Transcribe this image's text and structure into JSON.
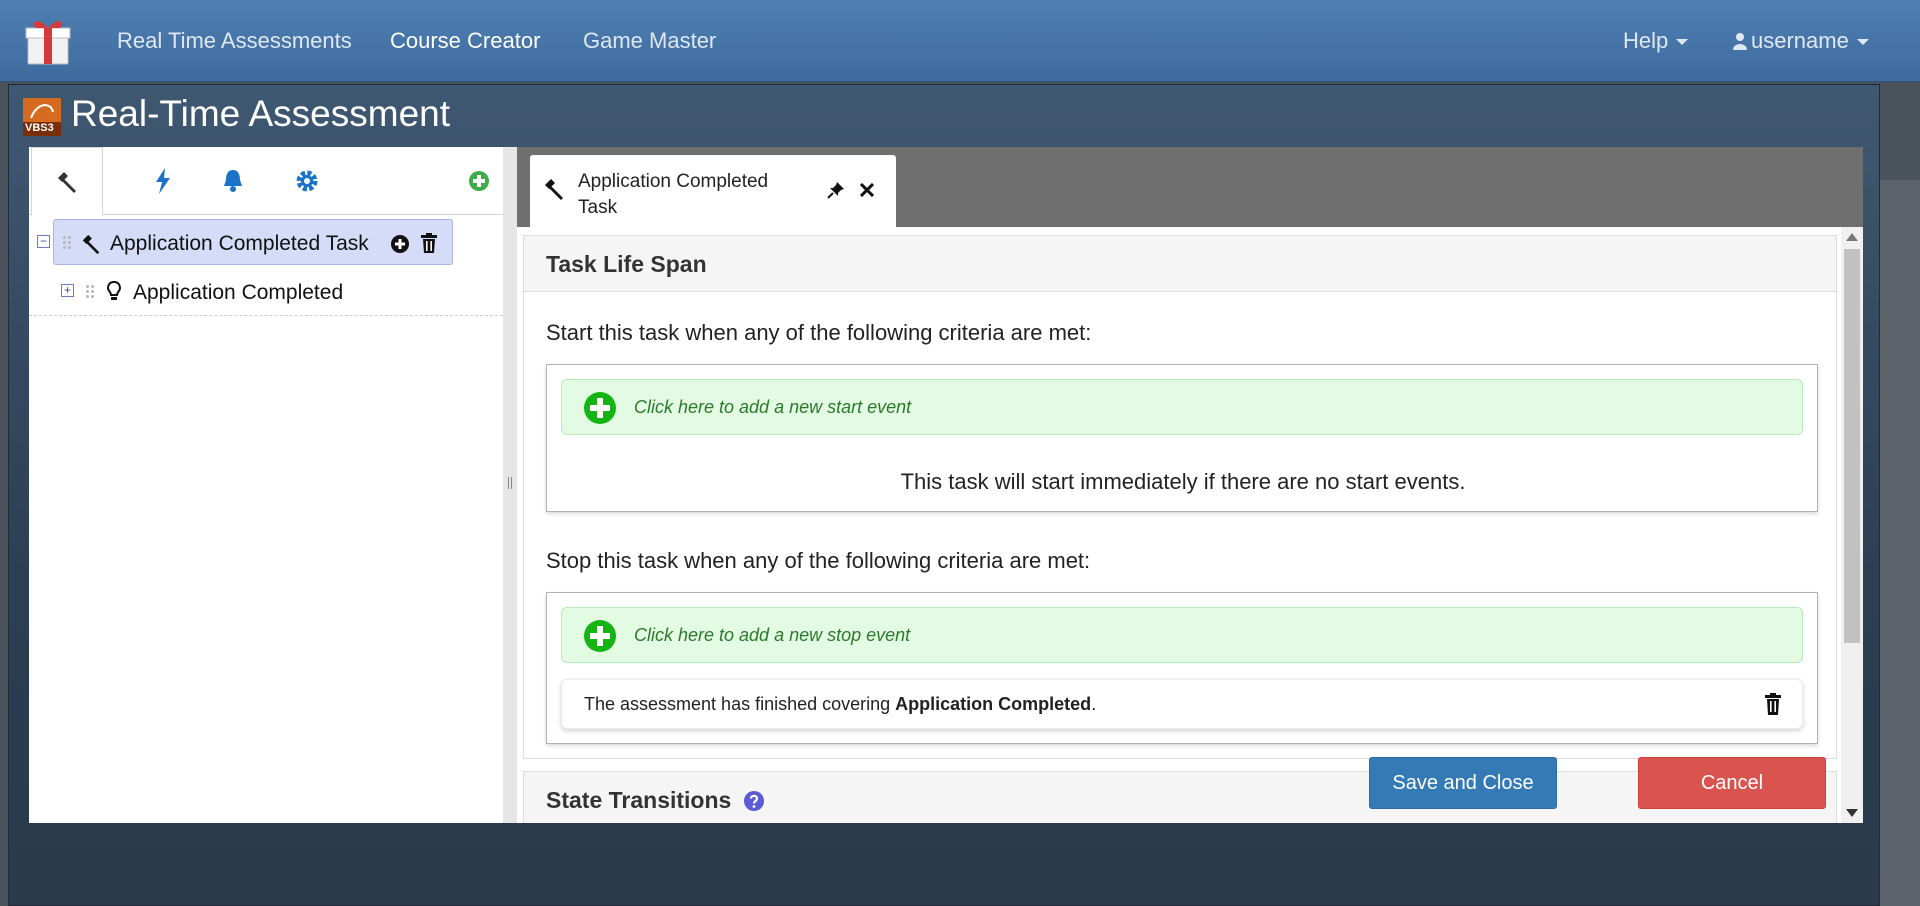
{
  "nav": {
    "logo_icon": "gift-icon",
    "links": [
      "Real Time Assessments",
      "Course Creator",
      "Game Master"
    ],
    "active": "Course Creator",
    "help": "Help",
    "user": "username"
  },
  "modal": {
    "title": "Real-Time Assessment",
    "logo_text": "VBS3"
  },
  "left": {
    "tabs": [
      "hammer-icon",
      "lightning-icon",
      "bell-icon",
      "gear-icon"
    ],
    "tree": [
      {
        "label": "Application Completed Task",
        "icon": "hammer-icon"
      },
      {
        "label": "Application Completed",
        "icon": "lightbulb-icon"
      }
    ]
  },
  "doc_tab": {
    "label": "Application Completed Task"
  },
  "life_span": {
    "heading": "Task Life Span",
    "start_label": "Start this task when any of the following criteria are met:",
    "start_add": "Click here to add a new start event",
    "start_info": "This task will start immediately if there are no start events.",
    "stop_label": "Stop this task when any of the following criteria are met:",
    "stop_add": "Click here to add a new stop event",
    "stop_event_prefix": "The assessment has finished covering ",
    "stop_event_bold": "Application Completed",
    "stop_event_suffix": "."
  },
  "transitions": {
    "heading": "State Transitions"
  },
  "footer": {
    "save": "Save and Close",
    "cancel": "Cancel"
  },
  "colors": {
    "nav": "#4a7aae",
    "primary": "#337ab7",
    "danger": "#d9534f",
    "accent_green": "#15b415",
    "icon_blue": "#1a73c9"
  }
}
